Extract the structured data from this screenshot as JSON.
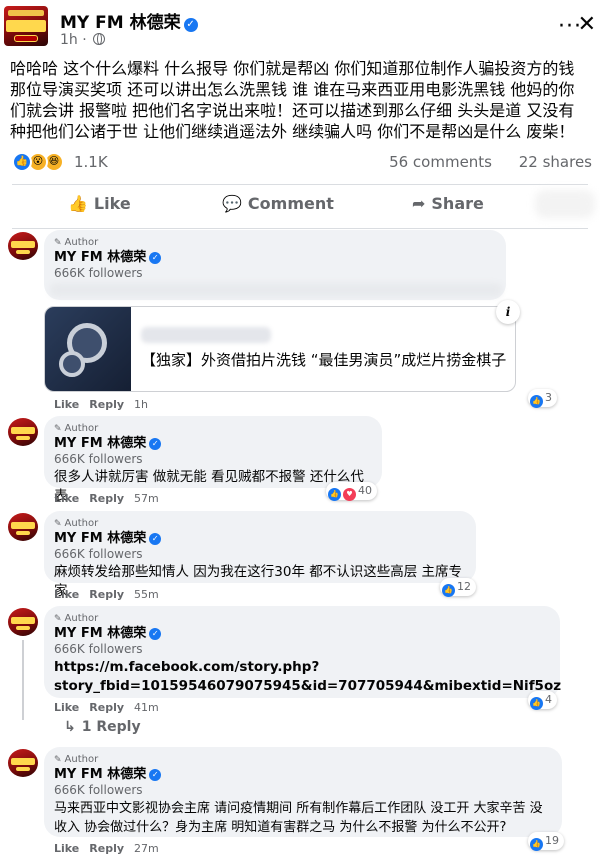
{
  "post": {
    "page_name": "MY FM 林德荣",
    "time": "1h",
    "text": "哈哈哈 这个什么爆料 什么报导 你们就是帮凶 你们知道那位制作人骗投资方的钱 那位导演买奖项 还可以讲出怎么洗黑钱 谁 谁在马来西亚用电影洗黑钱 他妈的你们就会讲 报警啦 把他们名字说出来啦！还可以描述到那么仔细 头头是道 又没有种把他们公诸于世 让他们继续逍遥法外 继续骗人吗 你们不是帮凶是什么 废柴！",
    "reaction_count": "1.1K",
    "comments_count": "56 comments",
    "shares_count": "22 shares",
    "icons": [
      "like-reaction",
      "wow-reaction",
      "haha-reaction"
    ]
  },
  "actions": {
    "like": "Like",
    "comment": "Comment",
    "share": "Share"
  },
  "comments": [
    {
      "author_tag": "Author",
      "name": "MY FM 林德荣",
      "followers": "666K followers",
      "link_title": "【独家】外资借拍片洗钱 “最佳男演员”成烂片捞金棋子",
      "like": "Like",
      "reply": "Reply",
      "time": "1h",
      "reactions": "3"
    },
    {
      "author_tag": "Author",
      "name": "MY FM 林德荣",
      "followers": "666K followers",
      "text": "很多人讲就厉害 做就无能 看见贼都不报警 还什么代表",
      "like": "Like",
      "reply": "Reply",
      "time": "57m",
      "reactions": "40"
    },
    {
      "author_tag": "Author",
      "name": "MY FM 林德荣",
      "followers": "666K followers",
      "text": "麻烦转发给那些知情人 因为我在这行30年 都不认识这些高层 主席专家",
      "like": "Like",
      "reply": "Reply",
      "time": "55m",
      "reactions": "12"
    },
    {
      "author_tag": "Author",
      "name": "MY FM 林德荣",
      "followers": "666K followers",
      "text_line1": "https://m.facebook.com/story.php?",
      "text_line2": "story_fbid=10159546079075945&id=707705944&mibextid=Nif5oz",
      "like": "Like",
      "reply": "Reply",
      "time": "41m",
      "reactions": "4",
      "replies": "1 Reply"
    },
    {
      "author_tag": "Author",
      "name": "MY FM 林德荣",
      "followers": "666K followers",
      "text_line1": "马来西亚中文影视协会主席 请问疫情期间 所有制作幕后工作团队 没工开 大家辛苦 没",
      "text_line2": "收入 协会做过什么？身为主席 明知道有害群之马 为什么不报警 为什么不公开?",
      "like": "Like",
      "reply": "Reply",
      "time": "27m",
      "reactions": "19"
    }
  ],
  "colors": {
    "accent": "#1877f2",
    "bubble": "#f0f2f5",
    "secondary_text": "#65676b"
  }
}
